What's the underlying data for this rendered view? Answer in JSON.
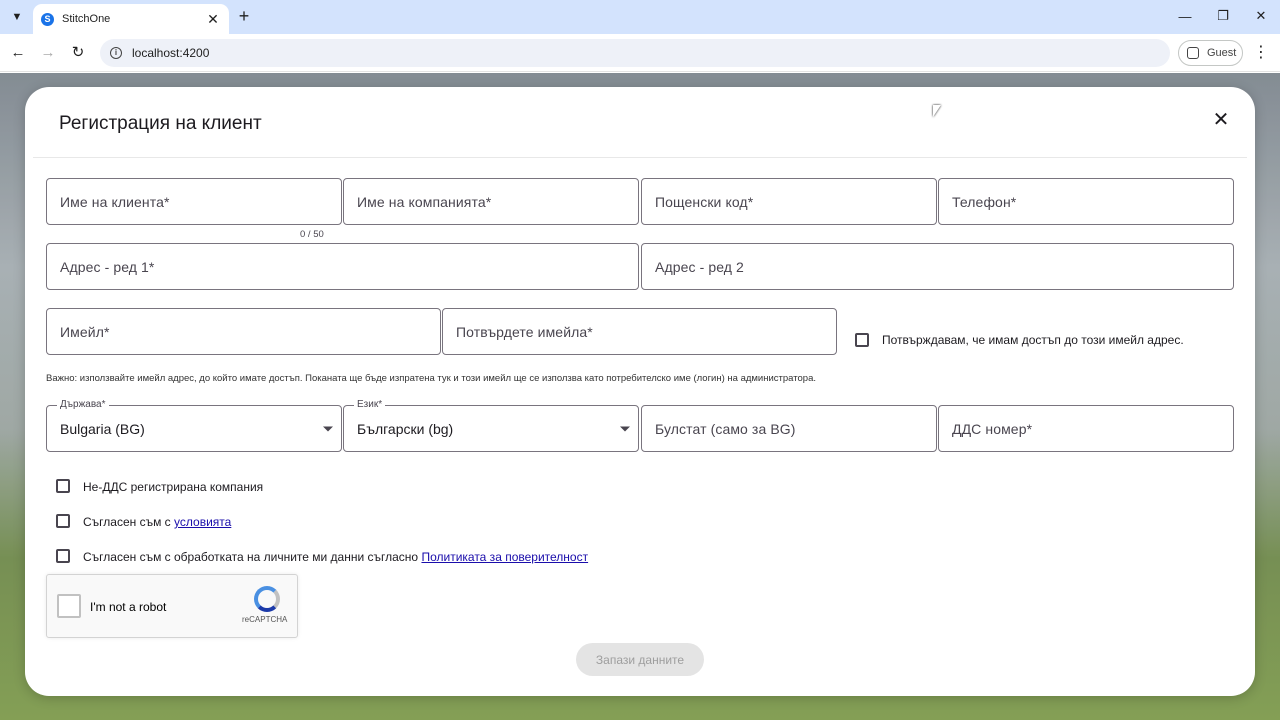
{
  "browser": {
    "tab_title": "StitchOne",
    "tab_favicon_letter": "S",
    "url": "localhost:4200",
    "profile_label": "Guest",
    "icons": {
      "tab_menu": "chevron-down-icon",
      "new_tab": "plus-icon",
      "back": "arrow-left-icon",
      "forward": "arrow-right-icon",
      "reload": "reload-icon",
      "site_info": "info-icon",
      "menu": "kebab-icon"
    }
  },
  "dialog": {
    "title": "Регистрация на клиент",
    "fields": {
      "client_name": "Име на клиента*",
      "client_name_counter": "0 / 50",
      "company_name": "Име на компанията*",
      "postal_code": "Пощенски код*",
      "phone": "Телефон*",
      "address1": "Адрес - ред 1*",
      "address2": "Адрес - ред 2",
      "email": "Имейл*",
      "confirm_email": "Потвърдете имейла*",
      "confirm_access_label": "Потвърждавам, че имам достъп до този имейл адрес.",
      "email_hint": "Важно: използвайте имейл адрес, до който имате достъп. Поканата ще бъде изпратена тук и този имейл ще се използва като потребителско име (логин) на администратора.",
      "country_label": "Държава*",
      "country_value": "Bulgaria (BG)",
      "language_label": "Език*",
      "language_value": "Български (bg)",
      "bulstat": "Булстат (само за BG)",
      "vat": "ДДС номер*"
    },
    "checkboxes": {
      "non_vat": "Не-ДДС регистрирана компания",
      "terms_prefix": "Съгласен съм с ",
      "terms_link": "условията",
      "privacy_prefix": "Съгласен съм с обработката на личните ми данни съгласно ",
      "privacy_link": "Политиката за поверителност"
    },
    "recaptcha": {
      "label": "I'm not a robot",
      "brand": "reCAPTCHA"
    },
    "save_button": "Запази данните"
  }
}
